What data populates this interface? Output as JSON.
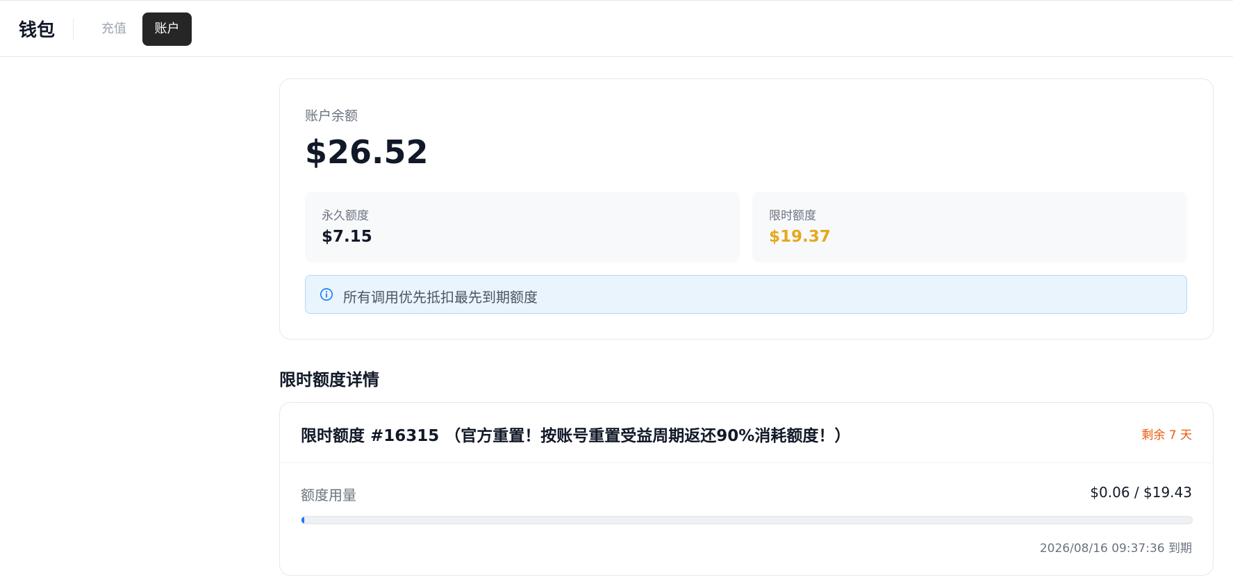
{
  "header": {
    "title": "钱包",
    "tabs": [
      {
        "label": "充值",
        "active": false
      },
      {
        "label": "账户",
        "active": true
      }
    ]
  },
  "balance": {
    "label": "账户余额",
    "amount": "$26.52",
    "permanent": {
      "label": "永久额度",
      "value": "$7.15"
    },
    "temporary": {
      "label": "限时额度",
      "value": "$19.37"
    },
    "notice": {
      "icon": "info-icon",
      "text": "所有调用优先抵扣最先到期额度"
    }
  },
  "details": {
    "section_title": "限时额度详情",
    "items": [
      {
        "title": "限时额度 #16315 （官方重置！按账号重置受益周期返还90%消耗额度！）",
        "remaining": "剩余 7 天",
        "usage_label": "额度用量",
        "usage_value": "$0.06 / $19.43",
        "usage_fraction": 0.0031,
        "expiry": "2026/08/16 09:37:36 到期"
      }
    ]
  },
  "colors": {
    "accent_dark": "#262626",
    "gold": "#e5a91c",
    "warning_orange": "#ea580c",
    "info_blue": "#1677ff"
  }
}
